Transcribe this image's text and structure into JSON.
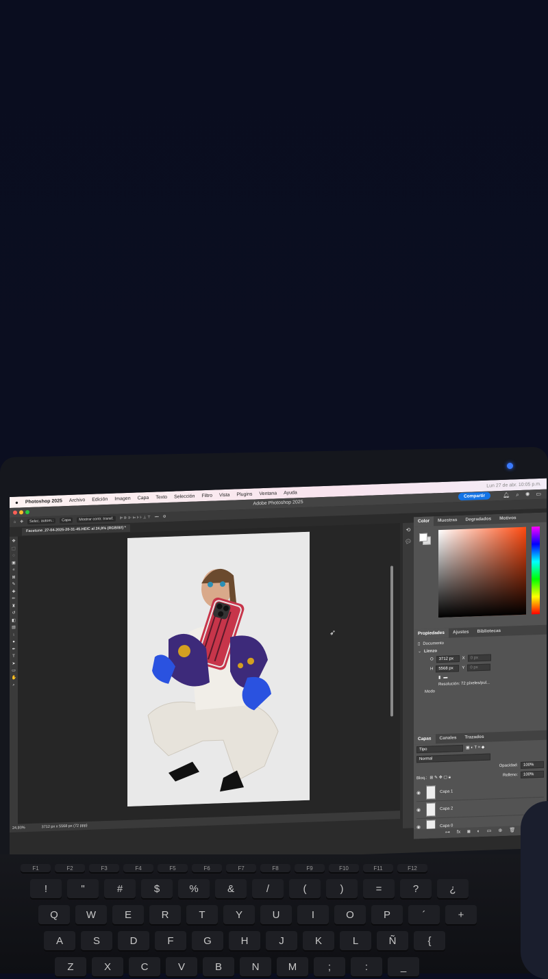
{
  "menubar": {
    "apple": "",
    "app_name": "Photoshop 2025",
    "menus": [
      "Archivo",
      "Edición",
      "Imagen",
      "Capa",
      "Texto",
      "Selección",
      "Filtro",
      "Vista",
      "Plugins",
      "Ventana",
      "Ayuda"
    ],
    "clock": "Lun 27 de abr. 10:05 p.m."
  },
  "titlebar": {
    "title": "Adobe Photoshop 2025",
    "share": "Compartir"
  },
  "optbar": {
    "auto_select": "Selec. autom.:",
    "layer_option": "Capa",
    "transform": "Mostrar contr. transf."
  },
  "document": {
    "tab": "Facetune_27-04-2025-20-31-45.HEIC al 24,9% (RGB/8#) *"
  },
  "statusbar": {
    "zoom": "24,93%",
    "dims": "3712 px x 5568 px (72 ppp)"
  },
  "color_panel": {
    "tabs": [
      "Color",
      "Muestras",
      "Degradados",
      "Motivos"
    ]
  },
  "properties_panel": {
    "tabs": [
      "Propiedades",
      "Ajustes",
      "Bibliotecas"
    ],
    "doc_label": "Documento",
    "section": "Lienzo",
    "width_label": "O",
    "width": "3712 px",
    "height_label": "H",
    "height": "5568 px",
    "x_label": "X",
    "x": "0 px",
    "y_label": "Y",
    "y": "0 px",
    "resolution": "Resolución: 72 píxeles/pul...",
    "mode": "Modo"
  },
  "layers_panel": {
    "tabs": [
      "Capas",
      "Canales",
      "Trazados"
    ],
    "filter": "Tipo",
    "blend": "Normal",
    "opacity_label": "Opacidad:",
    "opacity": "100%",
    "lock_label": "Bloq.:",
    "fill_label": "Relleno:",
    "fill": "100%",
    "layers": [
      "Capa 1",
      "Capa 2",
      "Capa 0"
    ]
  },
  "keyboard": {
    "row_fn": [
      "F1",
      "F2",
      "F3",
      "F4",
      "F5",
      "F6",
      "F7",
      "F8",
      "F9",
      "F10",
      "F11",
      "F12"
    ],
    "row_num": [
      "!",
      "\"",
      "#",
      "$",
      "%",
      "&",
      "/",
      "(",
      ")",
      "=",
      "?",
      "¿"
    ],
    "row_q": [
      "Q",
      "W",
      "E",
      "R",
      "T",
      "Y",
      "U",
      "I",
      "O",
      "P",
      "´",
      "+"
    ],
    "row_a": [
      "A",
      "S",
      "D",
      "F",
      "G",
      "H",
      "J",
      "K",
      "L",
      "Ñ",
      "{"
    ],
    "row_z": [
      "Z",
      "X",
      "C",
      "V",
      "B",
      "N",
      "M",
      ";",
      ":",
      "_"
    ]
  }
}
